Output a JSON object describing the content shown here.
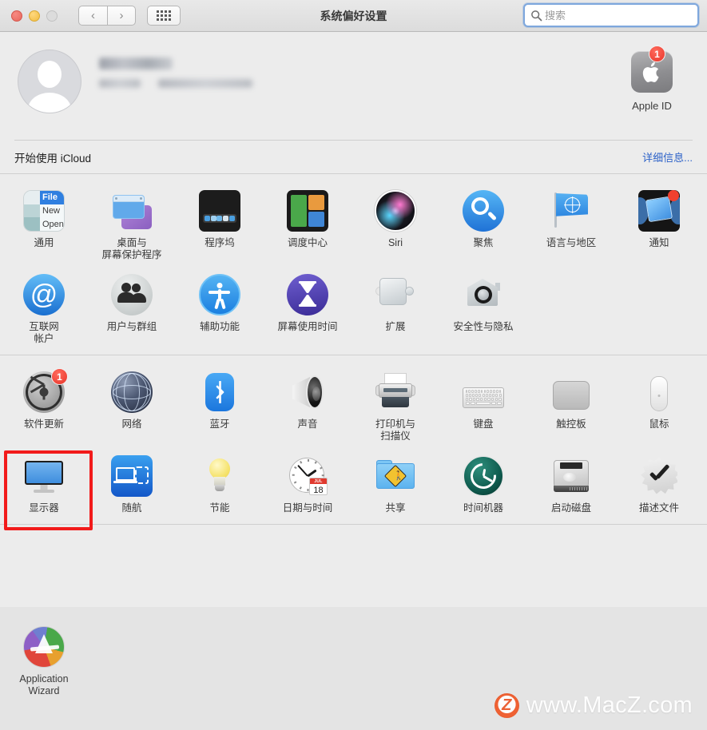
{
  "window": {
    "title": "系统偏好设置",
    "traffic_lights": [
      "close",
      "minimize",
      "zoom"
    ],
    "nav_back": "‹",
    "nav_forward": "›",
    "grid_button": "show-all-grid"
  },
  "search": {
    "placeholder": "搜索",
    "value": "",
    "icon": "search-icon",
    "focus_color": "#7ea7dd"
  },
  "account": {
    "name_redacted": "",
    "detail_redacted": "",
    "apple_id_label": "Apple ID",
    "apple_id_badge": "1"
  },
  "icloud": {
    "label": "开始使用 iCloud",
    "link": "详细信息..."
  },
  "sections": [
    {
      "id": "personal",
      "rows": [
        [
          {
            "icon": "general-icon",
            "label": "通用",
            "glyph_text": [
              "File",
              "New",
              "Open"
            ]
          },
          {
            "icon": "desktop-screensaver-icon",
            "label": "桌面与\n屏幕保护程序"
          },
          {
            "icon": "dock-icon",
            "label": "程序坞"
          },
          {
            "icon": "mission-control-icon",
            "label": "调度中心"
          },
          {
            "icon": "siri-icon",
            "label": "Siri"
          },
          {
            "icon": "spotlight-icon",
            "label": "聚焦"
          },
          {
            "icon": "language-region-icon",
            "label": "语言与地区"
          },
          {
            "icon": "notifications-icon",
            "label": "通知"
          }
        ],
        [
          {
            "icon": "internet-accounts-icon",
            "label": "互联网\n帐户"
          },
          {
            "icon": "users-groups-icon",
            "label": "用户与群组"
          },
          {
            "icon": "accessibility-icon",
            "label": "辅助功能"
          },
          {
            "icon": "screen-time-icon",
            "label": "屏幕使用时间"
          },
          {
            "icon": "extensions-icon",
            "label": "扩展"
          },
          {
            "icon": "security-privacy-icon",
            "label": "安全性与隐私"
          }
        ]
      ]
    },
    {
      "id": "hardware",
      "rows": [
        [
          {
            "icon": "software-update-icon",
            "label": "软件更新",
            "badge": "1"
          },
          {
            "icon": "network-icon",
            "label": "网络"
          },
          {
            "icon": "bluetooth-icon",
            "label": "蓝牙"
          },
          {
            "icon": "sound-icon",
            "label": "声音"
          },
          {
            "icon": "printers-scanners-icon",
            "label": "打印机与\n扫描仪"
          },
          {
            "icon": "keyboard-icon",
            "label": "键盘"
          },
          {
            "icon": "trackpad-icon",
            "label": "触控板"
          },
          {
            "icon": "mouse-icon",
            "label": "鼠标"
          }
        ],
        [
          {
            "icon": "displays-icon",
            "label": "显示器",
            "highlighted": true
          },
          {
            "icon": "sidecar-icon",
            "label": "随航"
          },
          {
            "icon": "energy-saver-icon",
            "label": "节能"
          },
          {
            "icon": "date-time-icon",
            "label": "日期与时间",
            "calendar_month": "JUL",
            "calendar_day": "18"
          },
          {
            "icon": "sharing-icon",
            "label": "共享"
          },
          {
            "icon": "time-machine-icon",
            "label": "时间机器"
          },
          {
            "icon": "startup-disk-icon",
            "label": "启动磁盘"
          },
          {
            "icon": "profiles-icon",
            "label": "描述文件"
          }
        ]
      ]
    },
    {
      "id": "other",
      "rows": [
        [
          {
            "icon": "application-wizard-icon",
            "label": "Application\nWizard"
          }
        ]
      ]
    }
  ],
  "watermark": {
    "logo_letter": "Z",
    "text": "www.MacZ.com"
  },
  "colors": {
    "highlight_red": "#f21b1b",
    "link_blue": "#2d62c8",
    "badge_red": "#e8352a",
    "window_bg": "#ececec",
    "bottom_bg": "#e4e4e4"
  }
}
